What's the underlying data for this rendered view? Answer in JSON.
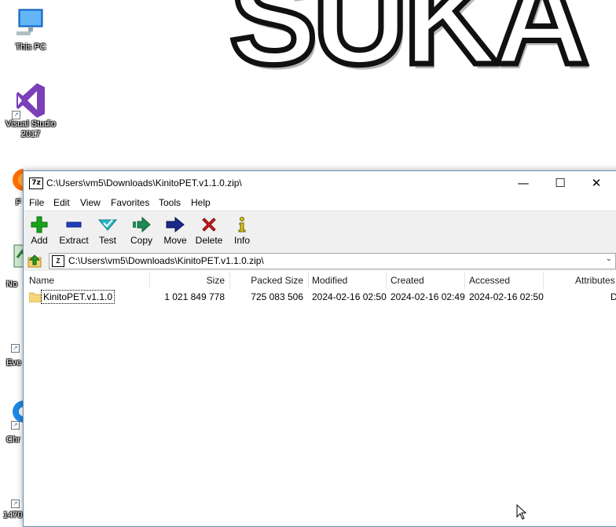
{
  "desktop": {
    "wallpaper_text": "SUKA",
    "icons": [
      {
        "label": "This PC",
        "icon": "computer-icon"
      },
      {
        "label": "Visual Studio 2017",
        "icon": "visual-studio-icon"
      }
    ],
    "partial_icons": [
      {
        "label": "F",
        "icon": "firefox-icon"
      },
      {
        "label": "No",
        "icon": "notepad-icon"
      },
      {
        "label": "Eve",
        "icon": "everything-icon"
      },
      {
        "label": "Chr",
        "icon": "chrome-icon"
      },
      {
        "label": "1470",
        "icon": "file-icon"
      }
    ]
  },
  "window": {
    "title": "C:\\Users\\vm5\\Downloads\\KinitoPET.v1.1.0.zip\\",
    "controls": {
      "minimize": "—",
      "maximize": "☐",
      "close": "✕"
    },
    "menu": [
      "File",
      "Edit",
      "View",
      "Favorites",
      "Tools",
      "Help"
    ],
    "toolbar": [
      {
        "label": "Add",
        "icon": "add-icon",
        "color": "#1aa31a"
      },
      {
        "label": "Extract",
        "icon": "extract-icon",
        "color": "#1f3fbf"
      },
      {
        "label": "Test",
        "icon": "test-icon",
        "color": "#2ab8c6"
      },
      {
        "label": "Copy",
        "icon": "copy-icon",
        "color": "#1e8a55"
      },
      {
        "label": "Move",
        "icon": "move-icon",
        "color": "#1a2a8a"
      },
      {
        "label": "Delete",
        "icon": "delete-icon",
        "color": "#d41a1a"
      },
      {
        "label": "Info",
        "icon": "info-icon",
        "color": "#d9c21a"
      }
    ],
    "address": "C:\\Users\\vm5\\Downloads\\KinitoPET.v1.1.0.zip\\",
    "columns": [
      "Name",
      "Size",
      "Packed Size",
      "Modified",
      "Created",
      "Accessed",
      "Attributes"
    ],
    "rows": [
      {
        "name": "KinitoPET.v1.1.0",
        "size": "1 021 849 778",
        "packed_size": "725 083 506",
        "modified": "2024-02-16 02:50",
        "created": "2024-02-16 02:49",
        "accessed": "2024-02-16 02:50",
        "attributes": "D"
      }
    ]
  }
}
